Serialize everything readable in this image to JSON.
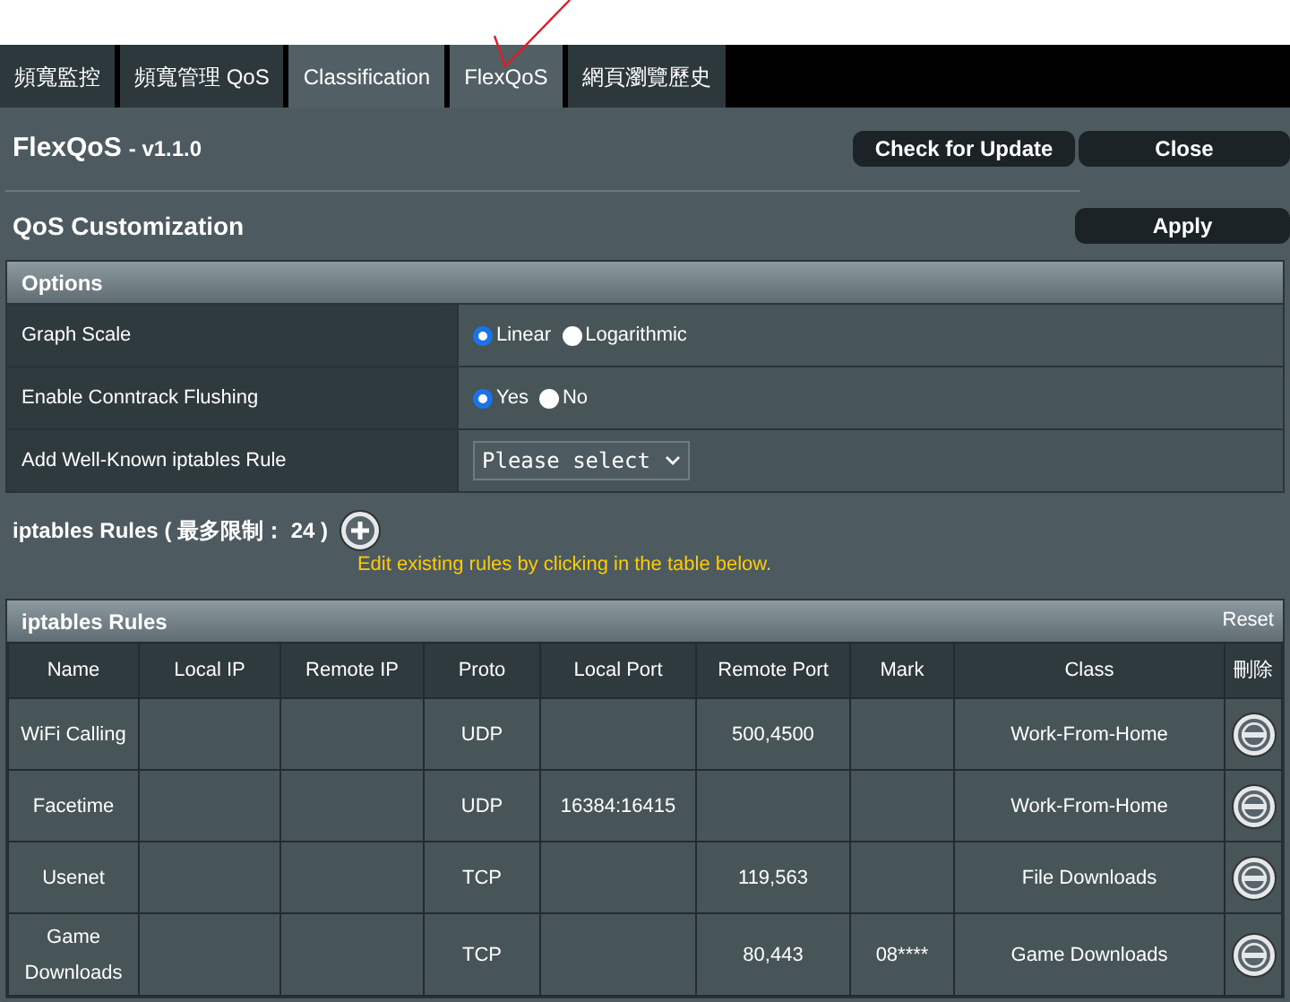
{
  "tabs": [
    {
      "label": "頻寬監控",
      "selected": false
    },
    {
      "label": "頻寬管理 QoS",
      "selected": false
    },
    {
      "label": "Classification",
      "selected": true
    },
    {
      "label": "FlexQoS",
      "selected": true
    },
    {
      "label": "網頁瀏覽歷史",
      "selected": false
    }
  ],
  "header": {
    "title": "FlexQoS",
    "version": "- v1.1.0",
    "buttons": [
      "Check for Update",
      "Close"
    ]
  },
  "customization": {
    "title": "QoS Customization",
    "button": "Apply"
  },
  "options": {
    "title": "Options",
    "rows": [
      {
        "kind": "radio",
        "label": "Graph Scale",
        "choices": [
          {
            "label": "Linear",
            "selected": true
          },
          {
            "label": "Logarithmic",
            "selected": false
          }
        ]
      },
      {
        "kind": "radio",
        "label": "Enable Conntrack Flushing",
        "choices": [
          {
            "label": "Yes",
            "selected": true
          },
          {
            "label": "No",
            "selected": false
          }
        ]
      },
      {
        "kind": "select",
        "label": "Add Well-Known iptables Rule",
        "value": "Please select"
      }
    ]
  },
  "rules_heading": "iptables Rules ( 最多限制： 24 )",
  "hint": "Edit existing rules by clicking in the table below.",
  "table": {
    "title": "iptables Rules",
    "reset": "Reset",
    "columns": [
      "Name",
      "Local IP",
      "Remote IP",
      "Proto",
      "Local Port",
      "Remote Port",
      "Mark",
      "Class",
      "刪除"
    ],
    "rows": [
      [
        "WiFi Calling",
        "",
        "",
        "UDP",
        "",
        "500,4500",
        "",
        "Work-From-Home"
      ],
      [
        "Facetime",
        "",
        "",
        "UDP",
        "16384:16415",
        "",
        "",
        "Work-From-Home"
      ],
      [
        "Usenet",
        "",
        "",
        "TCP",
        "",
        "119,563",
        "",
        "File Downloads"
      ],
      [
        "Game Downloads",
        "",
        "",
        "TCP",
        "",
        "80,443",
        "08****",
        "Game Downloads"
      ]
    ]
  }
}
